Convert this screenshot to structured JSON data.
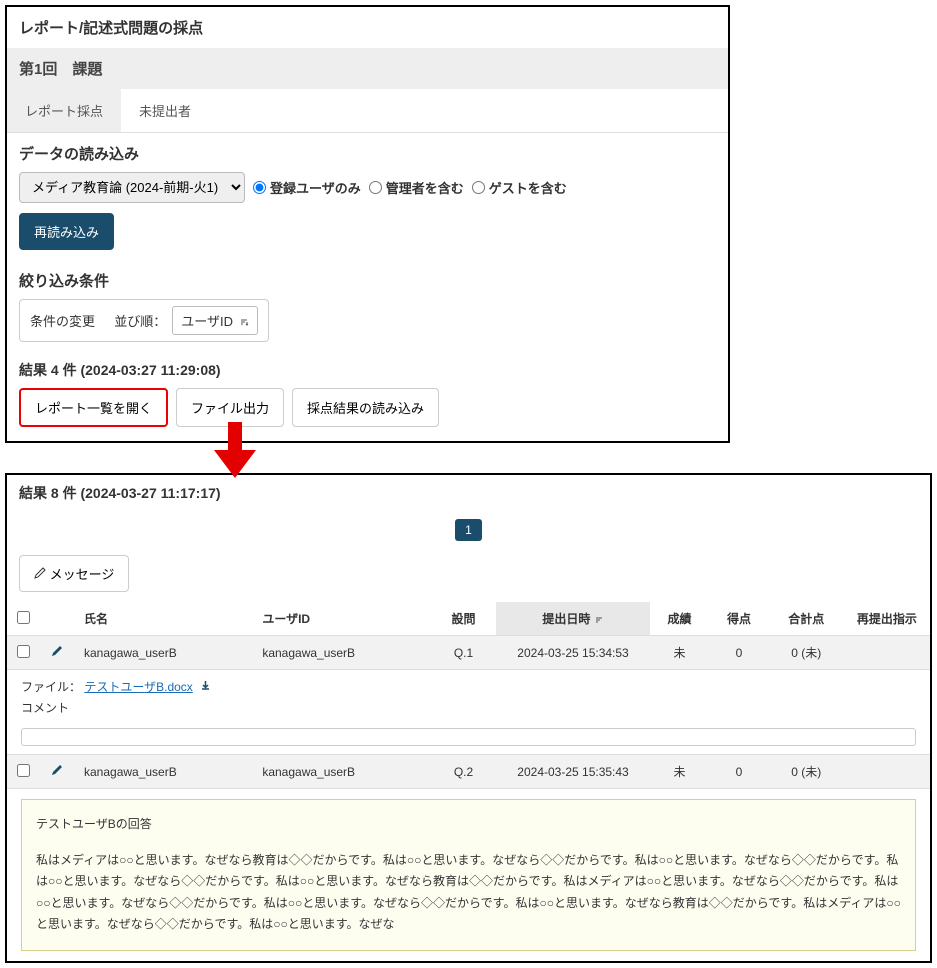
{
  "top": {
    "title": "レポート/記述式問題の採点",
    "subtitle": "第1回　課題",
    "tabs": {
      "t1": "レポート採点",
      "t2": "未提出者"
    },
    "load": {
      "heading": "データの読み込み",
      "course_option": "メディア教育論 (2024-前期-火1)",
      "r1": "登録ユーザのみ",
      "r2": "管理者を含む",
      "r3": "ゲストを含む",
      "reload": "再読み込み"
    },
    "filter": {
      "heading": "絞り込み条件",
      "change": "条件の変更",
      "order_label": "並び順：",
      "order_value": "ユーザID"
    },
    "results": {
      "heading": "結果 4 件 (2024-03:27 11:29:08)",
      "b1": "レポート一覧を開く",
      "b2": "ファイル出力",
      "b3": "採点結果の読み込み"
    }
  },
  "bottom": {
    "heading": "結果 8 件 (2024-03-27 11:17:17)",
    "page": "1",
    "msg_btn": "メッセージ",
    "cols": {
      "name": "氏名",
      "uid": "ユーザID",
      "q": "設問",
      "dt": "提出日時",
      "grade": "成績",
      "score": "得点",
      "total": "合計点",
      "resubmit": "再提出指示"
    },
    "rows": [
      {
        "name": "kanagawa_userB",
        "uid": "kanagawa_userB",
        "q": "Q.1",
        "dt": "2024-03-25 15:34:53",
        "grade": "未",
        "score": "0",
        "total": "0 (未)"
      },
      {
        "name": "kanagawa_userB",
        "uid": "kanagawa_userB",
        "q": "Q.2",
        "dt": "2024-03-25 15:35:43",
        "grade": "未",
        "score": "0",
        "total": "0 (未)"
      }
    ],
    "file_label": "ファイル：",
    "file_name": "テストユーザB.docx",
    "comment_label": "コメント",
    "answer_title": "テストユーザBの回答",
    "answer_body": "私はメディアは○○と思います。なぜなら教育は◇◇だからです。私は○○と思います。なぜなら◇◇だからです。私は○○と思います。なぜなら◇◇だからです。私は○○と思います。なぜなら◇◇だからです。私は○○と思います。なぜなら教育は◇◇だからです。私はメディアは○○と思います。なぜなら◇◇だからです。私は○○と思います。なぜなら◇◇だからです。私は○○と思います。なぜなら◇◇だからです。私は○○と思います。なぜなら教育は◇◇だからです。私はメディアは○○と思います。なぜなら◇◇だからです。私は○○と思います。なぜな"
  }
}
